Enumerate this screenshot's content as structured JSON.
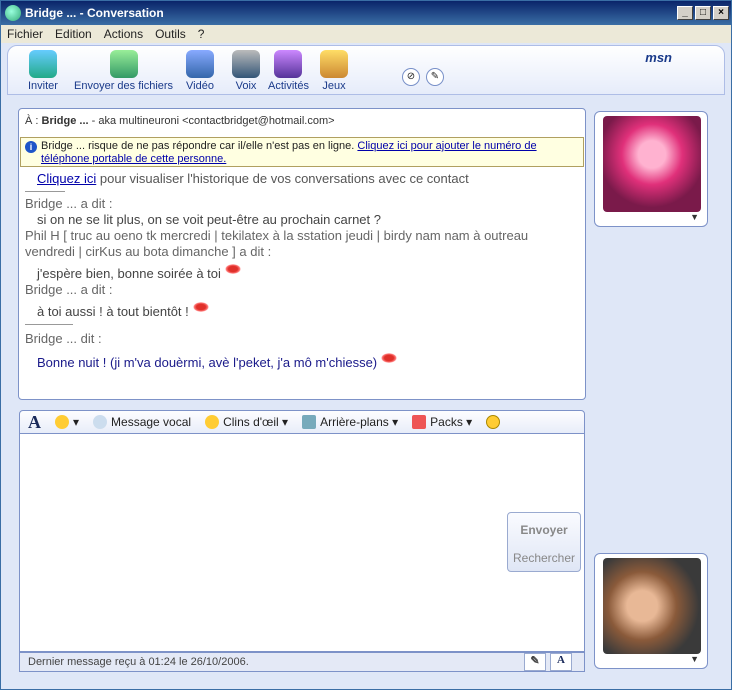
{
  "window": {
    "title": "Bridge ... - Conversation"
  },
  "menu": [
    "Fichier",
    "Edition",
    "Actions",
    "Outils",
    "?"
  ],
  "toolbar": {
    "items": [
      "Inviter",
      "Envoyer des fichiers",
      "Vidéo",
      "Voix",
      "Activités",
      "Jeux"
    ],
    "brand": "msn"
  },
  "to_line": {
    "label": "À :",
    "name": "Bridge ...",
    "details": "- aka multineuroni <contactbridget@hotmail.com>"
  },
  "warning": {
    "text": "Bridge ... risque de ne pas répondre car il/elle n'est pas en ligne.",
    "link": "Cliquez ici pour ajouter le numéro de téléphone portable de cette personne."
  },
  "history": {
    "link": "Cliquez ici",
    "link_suffix": "pour visualiser l'historique de vos conversations avec ce contact",
    "said1": "Bridge ... a dit :",
    "msg1": "si on ne se lit plus, on se voit peut-être au prochain carnet ?",
    "said2": "Phil H [ truc au oeno tk mercredi | tekilatex à la sstation jeudi | birdy nam nam à outreau vendredi | cirKus au bota dimanche ] a dit :",
    "msg2": "j'espère bien, bonne soirée à toi",
    "said3": "Bridge ... a dit :",
    "msg3": "à toi aussi ! à tout bientôt !",
    "said4": "Bridge ... dit :",
    "msg4": "Bonne nuit ! (ji m'va douèrmi, avè l'peket, j'a mô m'chiesse)"
  },
  "format_bar": {
    "vocal": "Message vocal",
    "winks": "Clins d'œil",
    "backgrounds": "Arrière-plans",
    "packs": "Packs"
  },
  "actions": {
    "send": "Envoyer",
    "search": "Rechercher"
  },
  "status": {
    "text": "Dernier message reçu à 01:24 le 26/10/2006."
  }
}
